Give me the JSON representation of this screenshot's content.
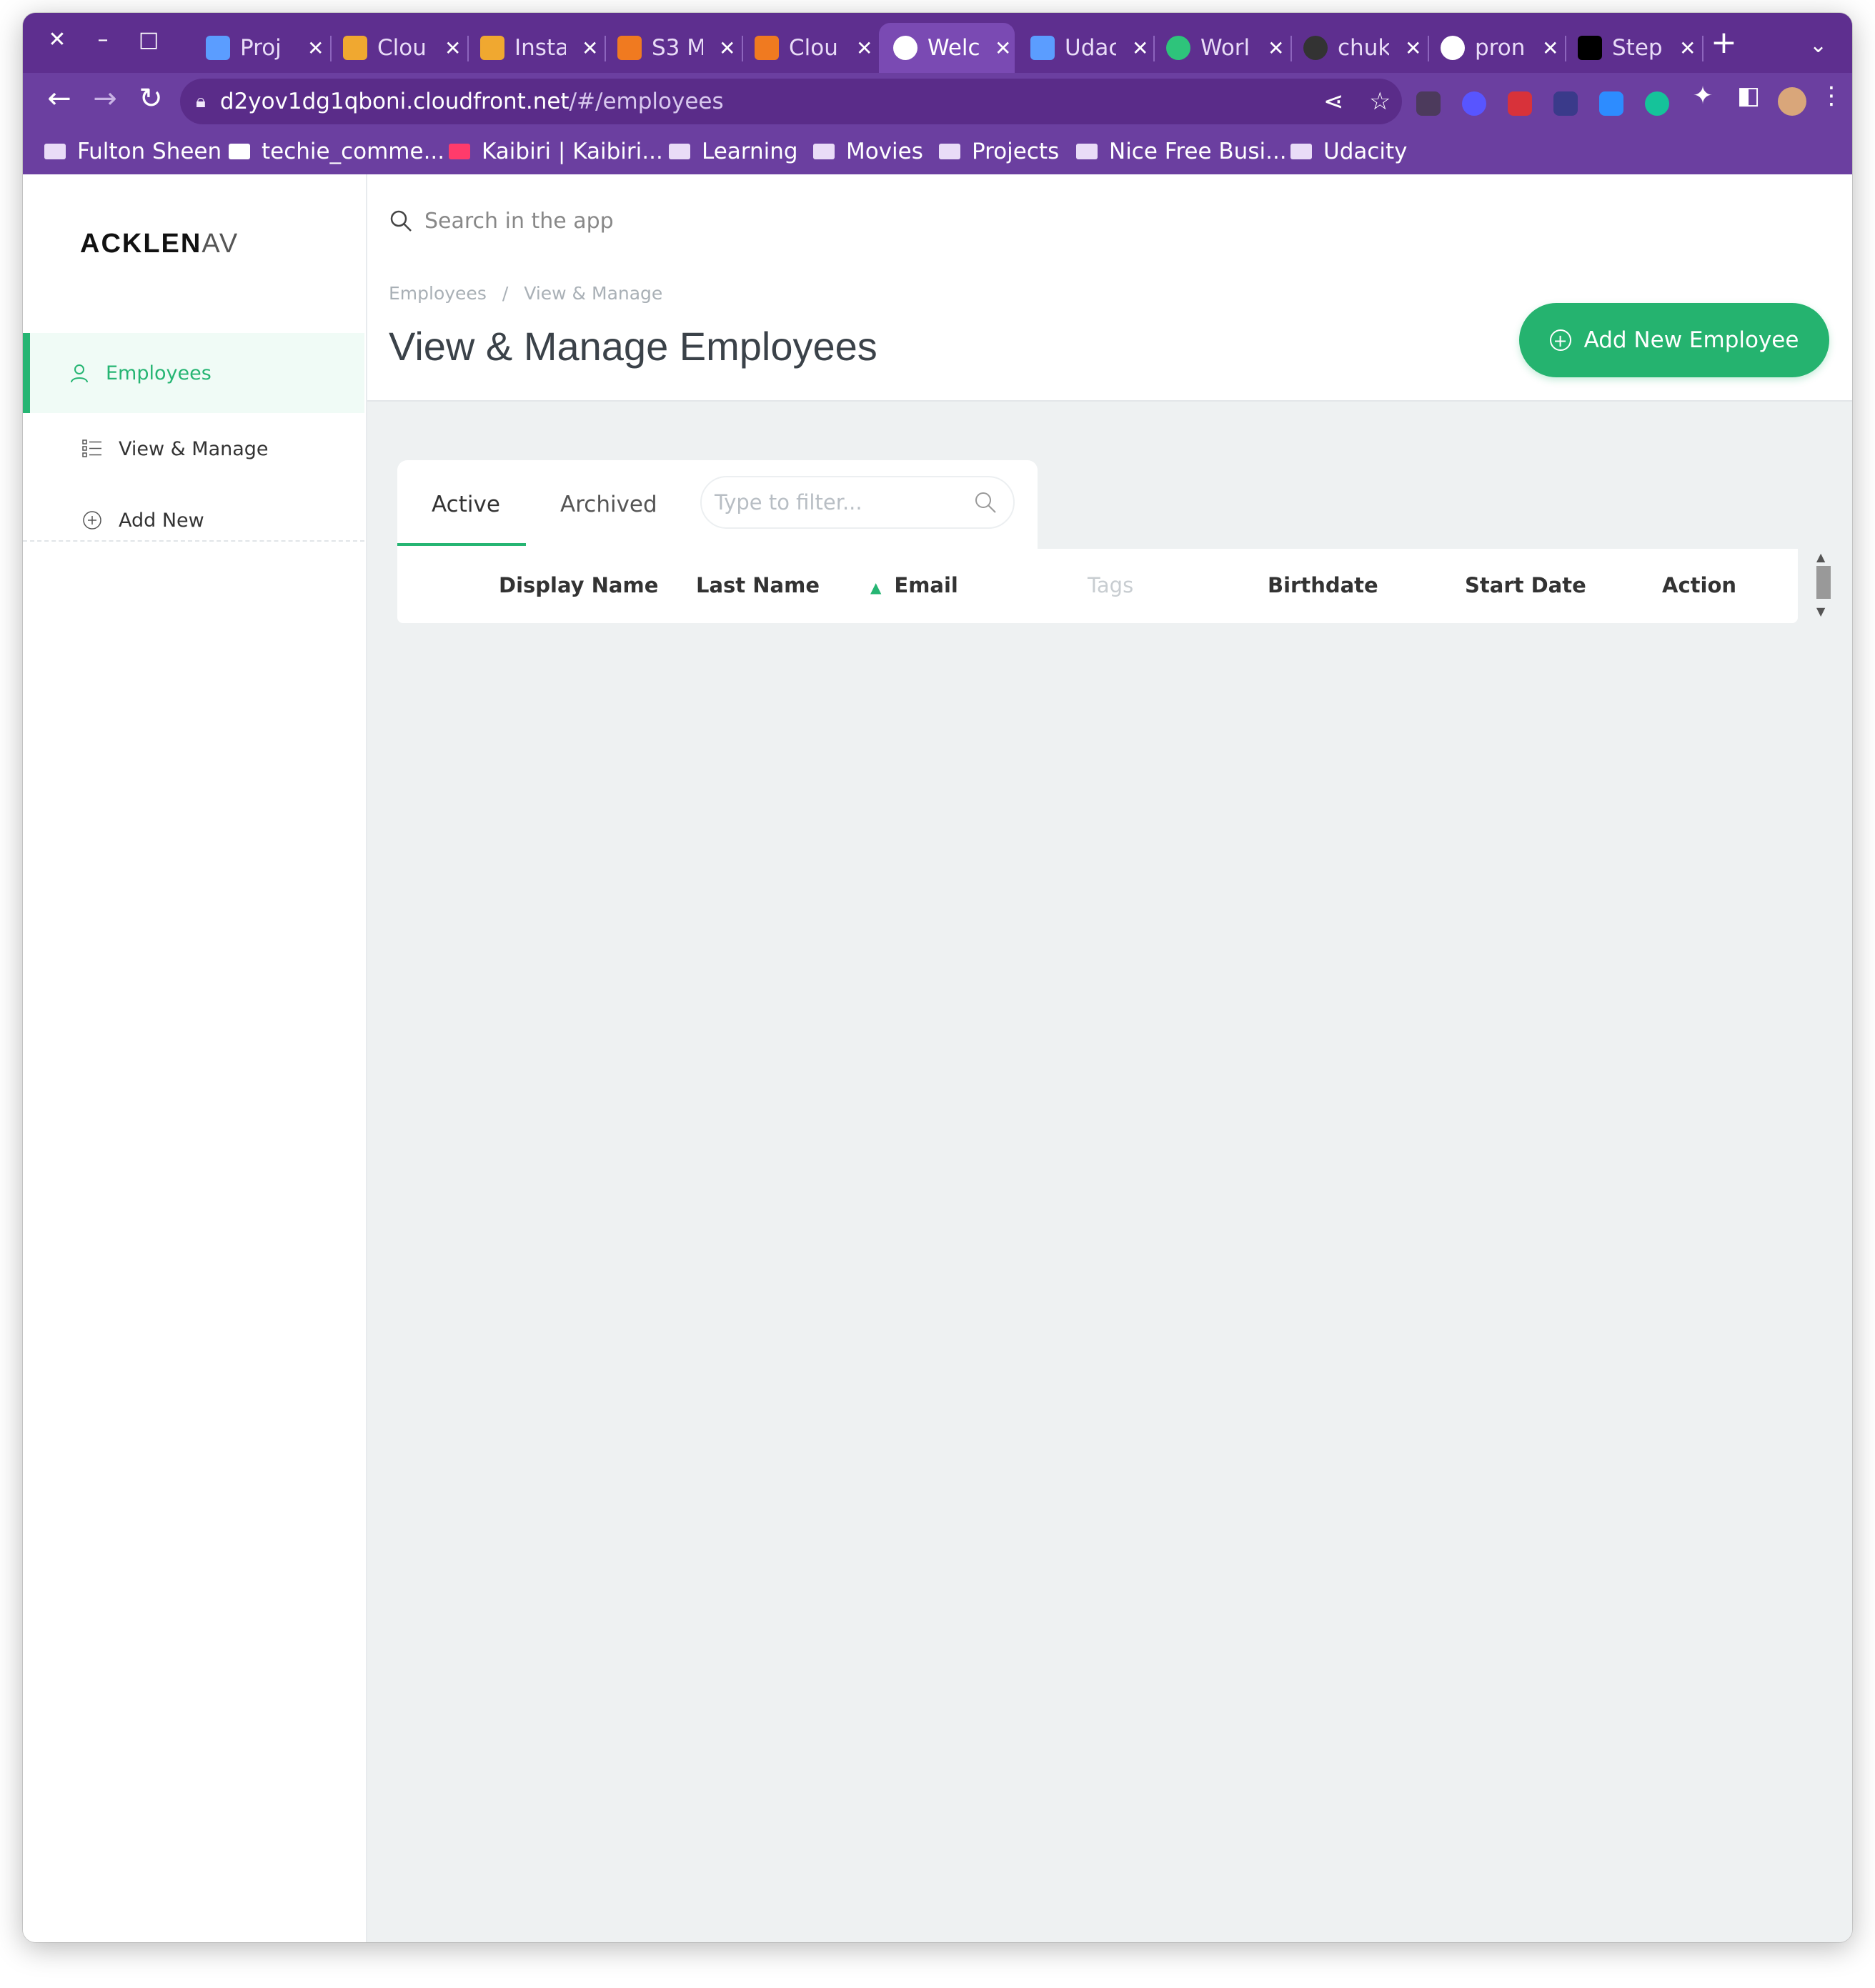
{
  "browser": {
    "tabs": [
      {
        "title": "Proj",
        "favicon_color": "#5b9dff"
      },
      {
        "title": "Clou",
        "favicon_color": "#f0a830"
      },
      {
        "title": "Insta",
        "favicon_color": "#f0a830"
      },
      {
        "title": "S3 M",
        "favicon_color": "#f07a20"
      },
      {
        "title": "Clou",
        "favicon_color": "#f07a20"
      },
      {
        "title": "Welc",
        "favicon_color": "#ffffff"
      },
      {
        "title": "Udac",
        "favicon_color": "#5b9dff"
      },
      {
        "title": "Worl",
        "favicon_color": "#2ec47b"
      },
      {
        "title": "chuk",
        "favicon_color": "#333333"
      },
      {
        "title": "pron",
        "favicon_color": "#ffffff"
      },
      {
        "title": "Step",
        "favicon_color": "#000000"
      }
    ],
    "url_host": "d2yov1dg1qboni.cloudfront.net",
    "url_path": "/#/employees",
    "bookmarks": [
      "Fulton Sheen",
      "techie_comme...",
      "Kaibiri | Kaibiri...",
      "Learning",
      "Movies",
      "Projects",
      "Nice Free Busi...",
      "Udacity"
    ]
  },
  "app": {
    "logo_bold": "ACKLEN",
    "logo_thin": "AV",
    "search_placeholder": "Search in the app",
    "sidebar": {
      "items": [
        {
          "label": "Employees",
          "icon": "user-icon"
        },
        {
          "label": "View & Manage",
          "icon": "list-icon"
        },
        {
          "label": "Add New",
          "icon": "plus-circle-icon"
        }
      ]
    },
    "breadcrumb": [
      "Employees",
      "View & Manage"
    ],
    "breadcrumb_separator": "/",
    "page_title": "View & Manage Employees",
    "add_button_label": "Add New Employee",
    "tabs": [
      "Active",
      "Archived"
    ],
    "filter_placeholder": "Type to filter...",
    "columns": [
      "Display Name",
      "Last Name",
      "Email",
      "Tags",
      "Birthdate",
      "Start Date",
      "Action"
    ],
    "accent_color": "#26b573",
    "chrome_color": "#6b3fa0"
  }
}
